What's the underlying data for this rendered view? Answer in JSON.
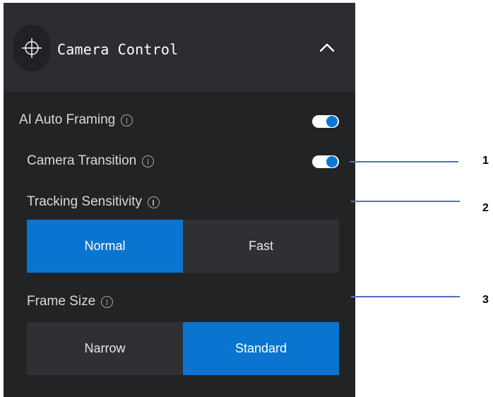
{
  "header": {
    "title": "Camera Control",
    "icon": "crosshair-icon",
    "collapse_icon": "chevron-up-icon"
  },
  "settings": {
    "ai_auto_framing": {
      "label": "AI Auto Framing",
      "enabled": true
    },
    "camera_transition": {
      "label": "Camera Transition",
      "enabled": true
    },
    "tracking_sensitivity": {
      "label": "Tracking Sensitivity",
      "options": [
        "Normal",
        "Fast"
      ],
      "selected": "Normal"
    },
    "frame_size": {
      "label": "Frame Size",
      "options": [
        "Narrow",
        "Standard"
      ],
      "selected": "Standard"
    }
  },
  "callouts": [
    "1",
    "2",
    "3"
  ],
  "colors": {
    "panel_bg": "#222325",
    "header_bg": "#2c2d30",
    "accent": "#0a74d1",
    "callout_line": "#4a74c4"
  }
}
